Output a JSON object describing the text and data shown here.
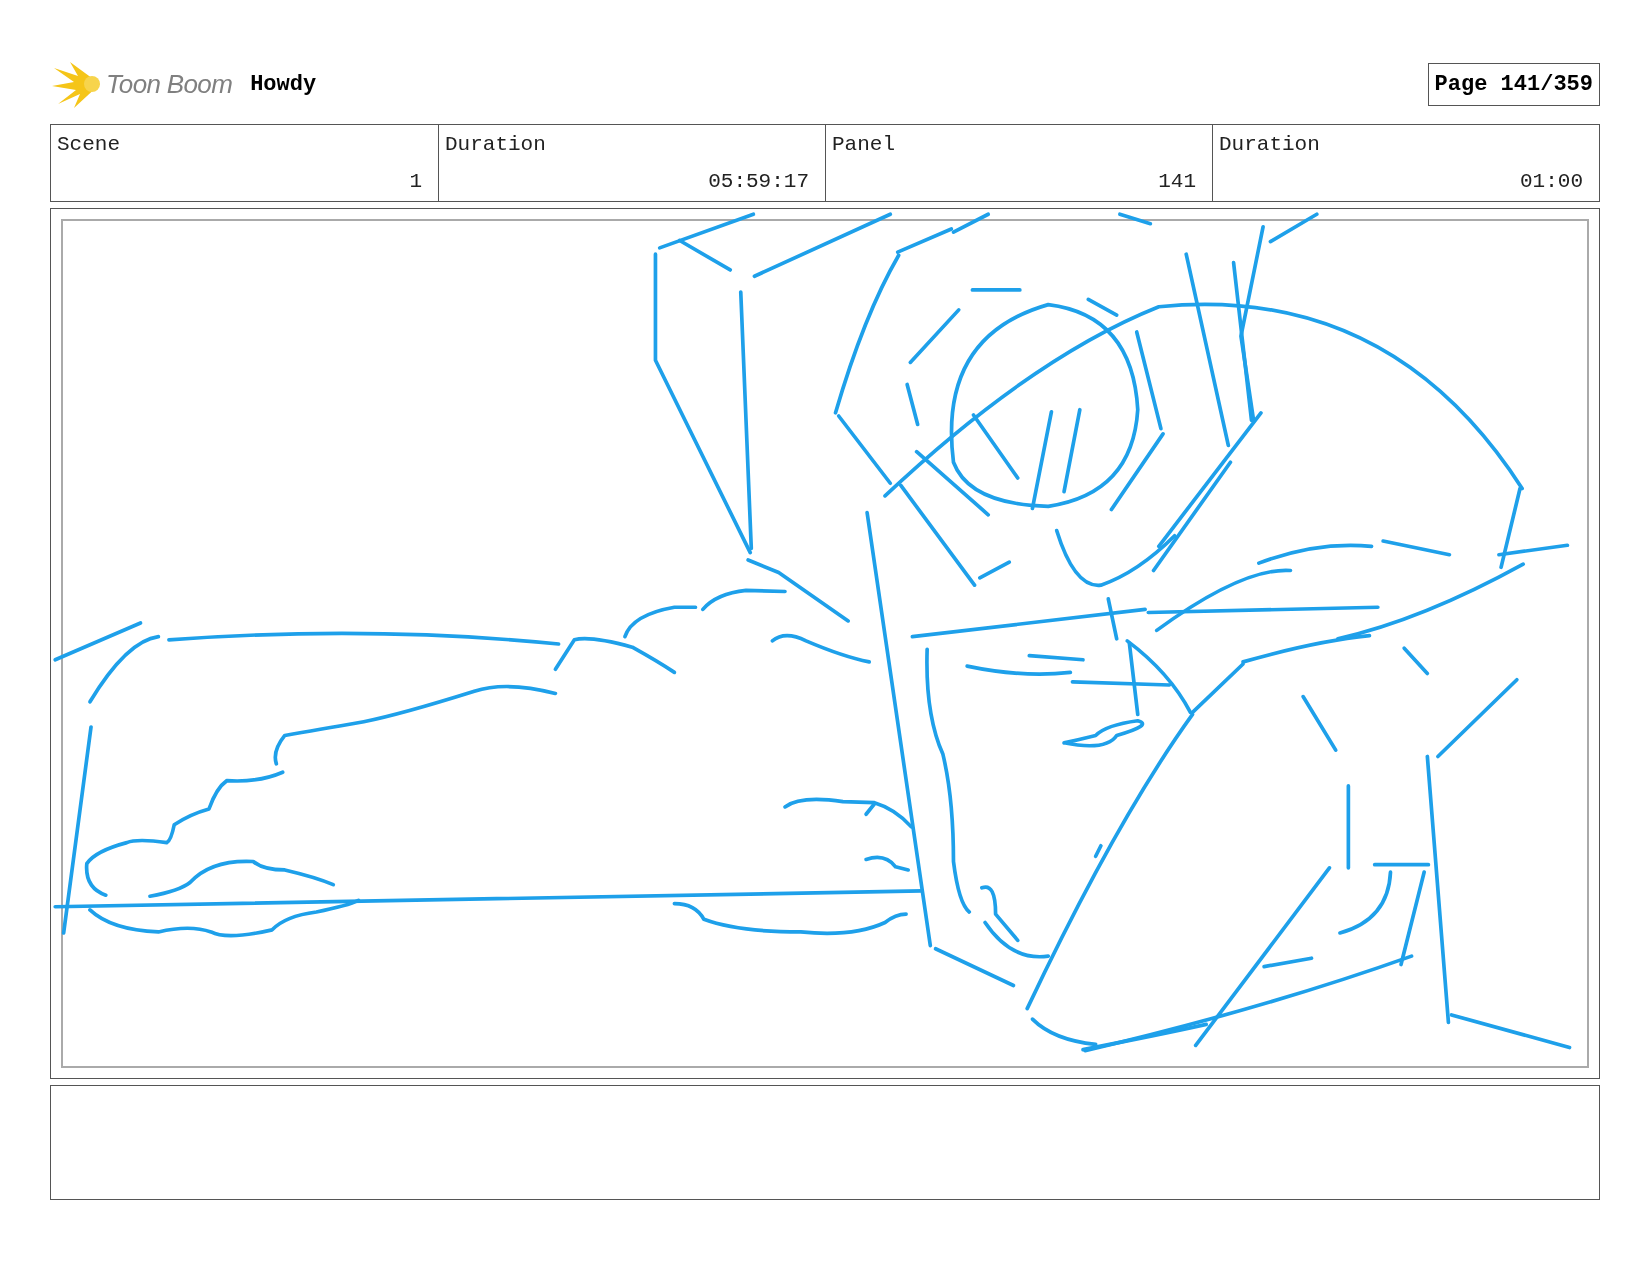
{
  "header": {
    "logo_text": "Toon Boom",
    "project": "Howdy",
    "page": "Page 141/359"
  },
  "info_cells": [
    {
      "label": "Scene",
      "value": "1"
    },
    {
      "label": "Duration",
      "value": "05:59:17"
    },
    {
      "label": "Panel",
      "value": "141"
    },
    {
      "label": "Duration",
      "value": "01:00"
    }
  ],
  "panel": {
    "kind": "sketch"
  }
}
